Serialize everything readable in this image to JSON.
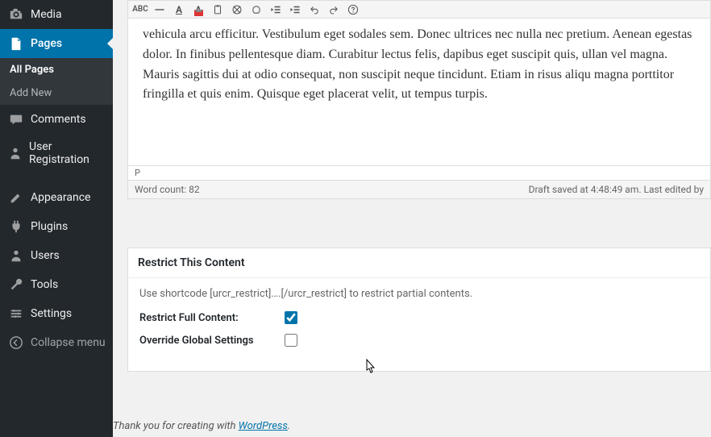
{
  "sidebar": {
    "items": [
      {
        "label": "Media",
        "icon": "media-icon",
        "current": false
      },
      {
        "label": "Pages",
        "icon": "pages-icon",
        "current": true
      },
      {
        "label": "Comments",
        "icon": "comments-icon",
        "current": false
      },
      {
        "label": "User Registration",
        "icon": "user-reg-icon",
        "current": false
      },
      {
        "label": "Appearance",
        "icon": "appearance-icon",
        "current": false
      },
      {
        "label": "Plugins",
        "icon": "plugins-icon",
        "current": false
      },
      {
        "label": "Users",
        "icon": "users-icon",
        "current": false
      },
      {
        "label": "Tools",
        "icon": "tools-icon",
        "current": false
      },
      {
        "label": "Settings",
        "icon": "settings-icon",
        "current": false
      }
    ],
    "subitems": [
      {
        "label": "All Pages",
        "active": true
      },
      {
        "label": "Add New",
        "active": false
      }
    ],
    "collapse_label": "Collapse menu"
  },
  "editor": {
    "toolbar": {
      "abc_label": "ABC",
      "underline_label": "A",
      "textcolor_label": "A"
    },
    "body_text": "vehicula arcu efficitur. Vestibulum eget sodales sem. Donec ultrices nec nulla nec pretium. Aenean egestas dolor. In finibus pellentesque diam. Curabitur lectus felis, dapibus eget suscipit quis, ullan vel magna. Mauris sagittis dui at odio consequat, non suscipit neque tincidunt. Etiam in risus aliqu magna porttitor fringilla et quis enim. Quisque eget placerat velit, ut tempus turpis.",
    "path_label": "P",
    "word_count_label": "Word count: 82",
    "draft_status": "Draft saved at 4:48:49 am. Last edited by "
  },
  "metabox": {
    "title": "Restrict This Content",
    "description": "Use shortcode [urcr_restrict]….[/urcr_restrict] to restrict partial contents.",
    "row1_label": "Restrict Full Content:",
    "row1_checked": true,
    "row2_label": "Override Global Settings",
    "row2_checked": false
  },
  "footer": {
    "prefix": "Thank you for creating with ",
    "link_text": "WordPress",
    "suffix": "."
  }
}
